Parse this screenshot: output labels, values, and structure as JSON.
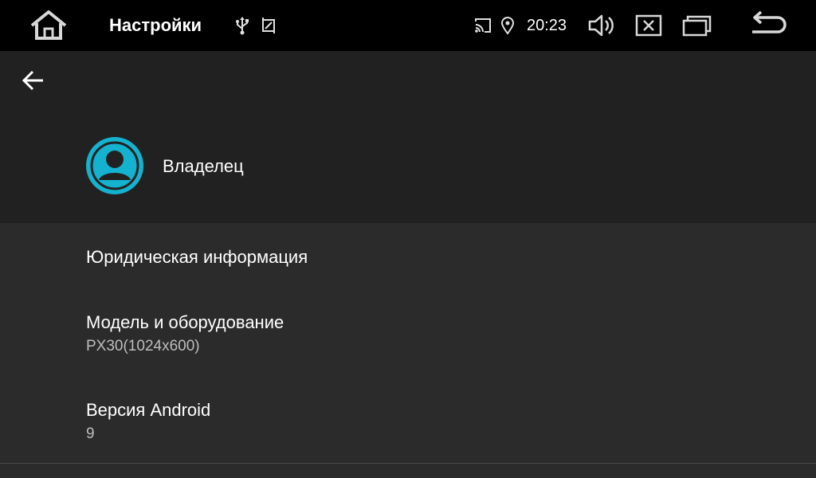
{
  "status_bar": {
    "app_title": "Настройки",
    "time": "20:23",
    "icons": {
      "home": "home-icon",
      "usb": "usb-icon",
      "screenshot": "screenshot-icon",
      "cast": "cast-icon",
      "location": "location-icon",
      "volume": "volume-icon",
      "close": "close-box-icon",
      "recents": "recent-apps-icon",
      "back": "back-return-icon"
    }
  },
  "header": {
    "back_icon": "arrow-left-icon",
    "owner_label": "Владелец",
    "avatar_color": "#15b2cf"
  },
  "preferences": [
    {
      "title": "Юридическая информация",
      "summary": ""
    },
    {
      "title": "Модель и оборудование",
      "summary": "PX30(1024x600)"
    },
    {
      "title": "Версия Android",
      "summary": "9"
    }
  ],
  "colors": {
    "status_bar_bg": "#000000",
    "header_bg": "#212121",
    "list_bg": "#2b2b2b",
    "accent": "#15b2cf"
  }
}
